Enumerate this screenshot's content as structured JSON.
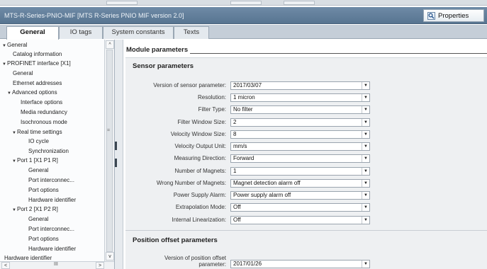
{
  "window": {
    "title": "MTS-R-Series-PNIO-MIF [MTS R-Series PNIO MIF version 2.0]"
  },
  "toolbar": {
    "properties_label": "Properties",
    "properties_icon": "properties-magnifier-icon"
  },
  "tabs": [
    {
      "label": "General",
      "active": true
    },
    {
      "label": "IO tags",
      "active": false
    },
    {
      "label": "System constants",
      "active": false
    },
    {
      "label": "Texts",
      "active": false
    }
  ],
  "tree": [
    {
      "label": "General",
      "expanded": true
    },
    {
      "label": "Catalog information"
    },
    {
      "label": "PROFINET interface [X1]",
      "expanded": true
    },
    {
      "label": "General"
    },
    {
      "label": "Ethernet addresses"
    },
    {
      "label": "Advanced options",
      "expanded": true
    },
    {
      "label": "Interface options"
    },
    {
      "label": "Media redundancy"
    },
    {
      "label": "Isochronous mode"
    },
    {
      "label": "Real time settings",
      "expanded": true
    },
    {
      "label": "IO cycle"
    },
    {
      "label": "Synchronization"
    },
    {
      "label": "Port 1 [X1 P1 R]",
      "expanded": true
    },
    {
      "label": "General"
    },
    {
      "label": "Port interconnec..."
    },
    {
      "label": "Port options"
    },
    {
      "label": "Hardware identifier"
    },
    {
      "label": "Port 2 [X1 P2 R]",
      "expanded": true
    },
    {
      "label": "General"
    },
    {
      "label": "Port interconnec..."
    },
    {
      "label": "Port options"
    },
    {
      "label": "Hardware identifier"
    },
    {
      "label": "Hardware identifier"
    }
  ],
  "scroll": {
    "up": "^",
    "down": "v",
    "left": "<",
    "right": ">",
    "mid_grip": "=",
    "h_grip": "III"
  },
  "main": {
    "section_title": "Module parameters",
    "sensor_group_title": "Sensor parameters",
    "sensor_fields": [
      {
        "label": "Version of sensor parameter:",
        "value": "2017/03/07"
      },
      {
        "label": "Resolution:",
        "value": "1 micron"
      },
      {
        "label": "Filter Type:",
        "value": "No filter"
      },
      {
        "label": "Filter Window Size:",
        "value": "2"
      },
      {
        "label": "Velocity Window Size:",
        "value": "8"
      },
      {
        "label": "Velocity Output Unit:",
        "value": "mm/s"
      },
      {
        "label": "Measuring Direction:",
        "value": "Forward"
      },
      {
        "label": "Number of Magnets:",
        "value": "1"
      },
      {
        "label": "Wrong Number of Magnets:",
        "value": "Magnet detection alarm off"
      },
      {
        "label": "Power Supply Alarm:",
        "value": "Power supply alarm off"
      },
      {
        "label": "Extrapolation Mode:",
        "value": "Off"
      },
      {
        "label": "Internal Linearization:",
        "value": "Off"
      }
    ],
    "position_group_title": "Position offset parameters",
    "position_fields": [
      {
        "label_line1": "Version of position offset",
        "label_line2": "parameter:",
        "value": "2017/01/26"
      }
    ]
  }
}
